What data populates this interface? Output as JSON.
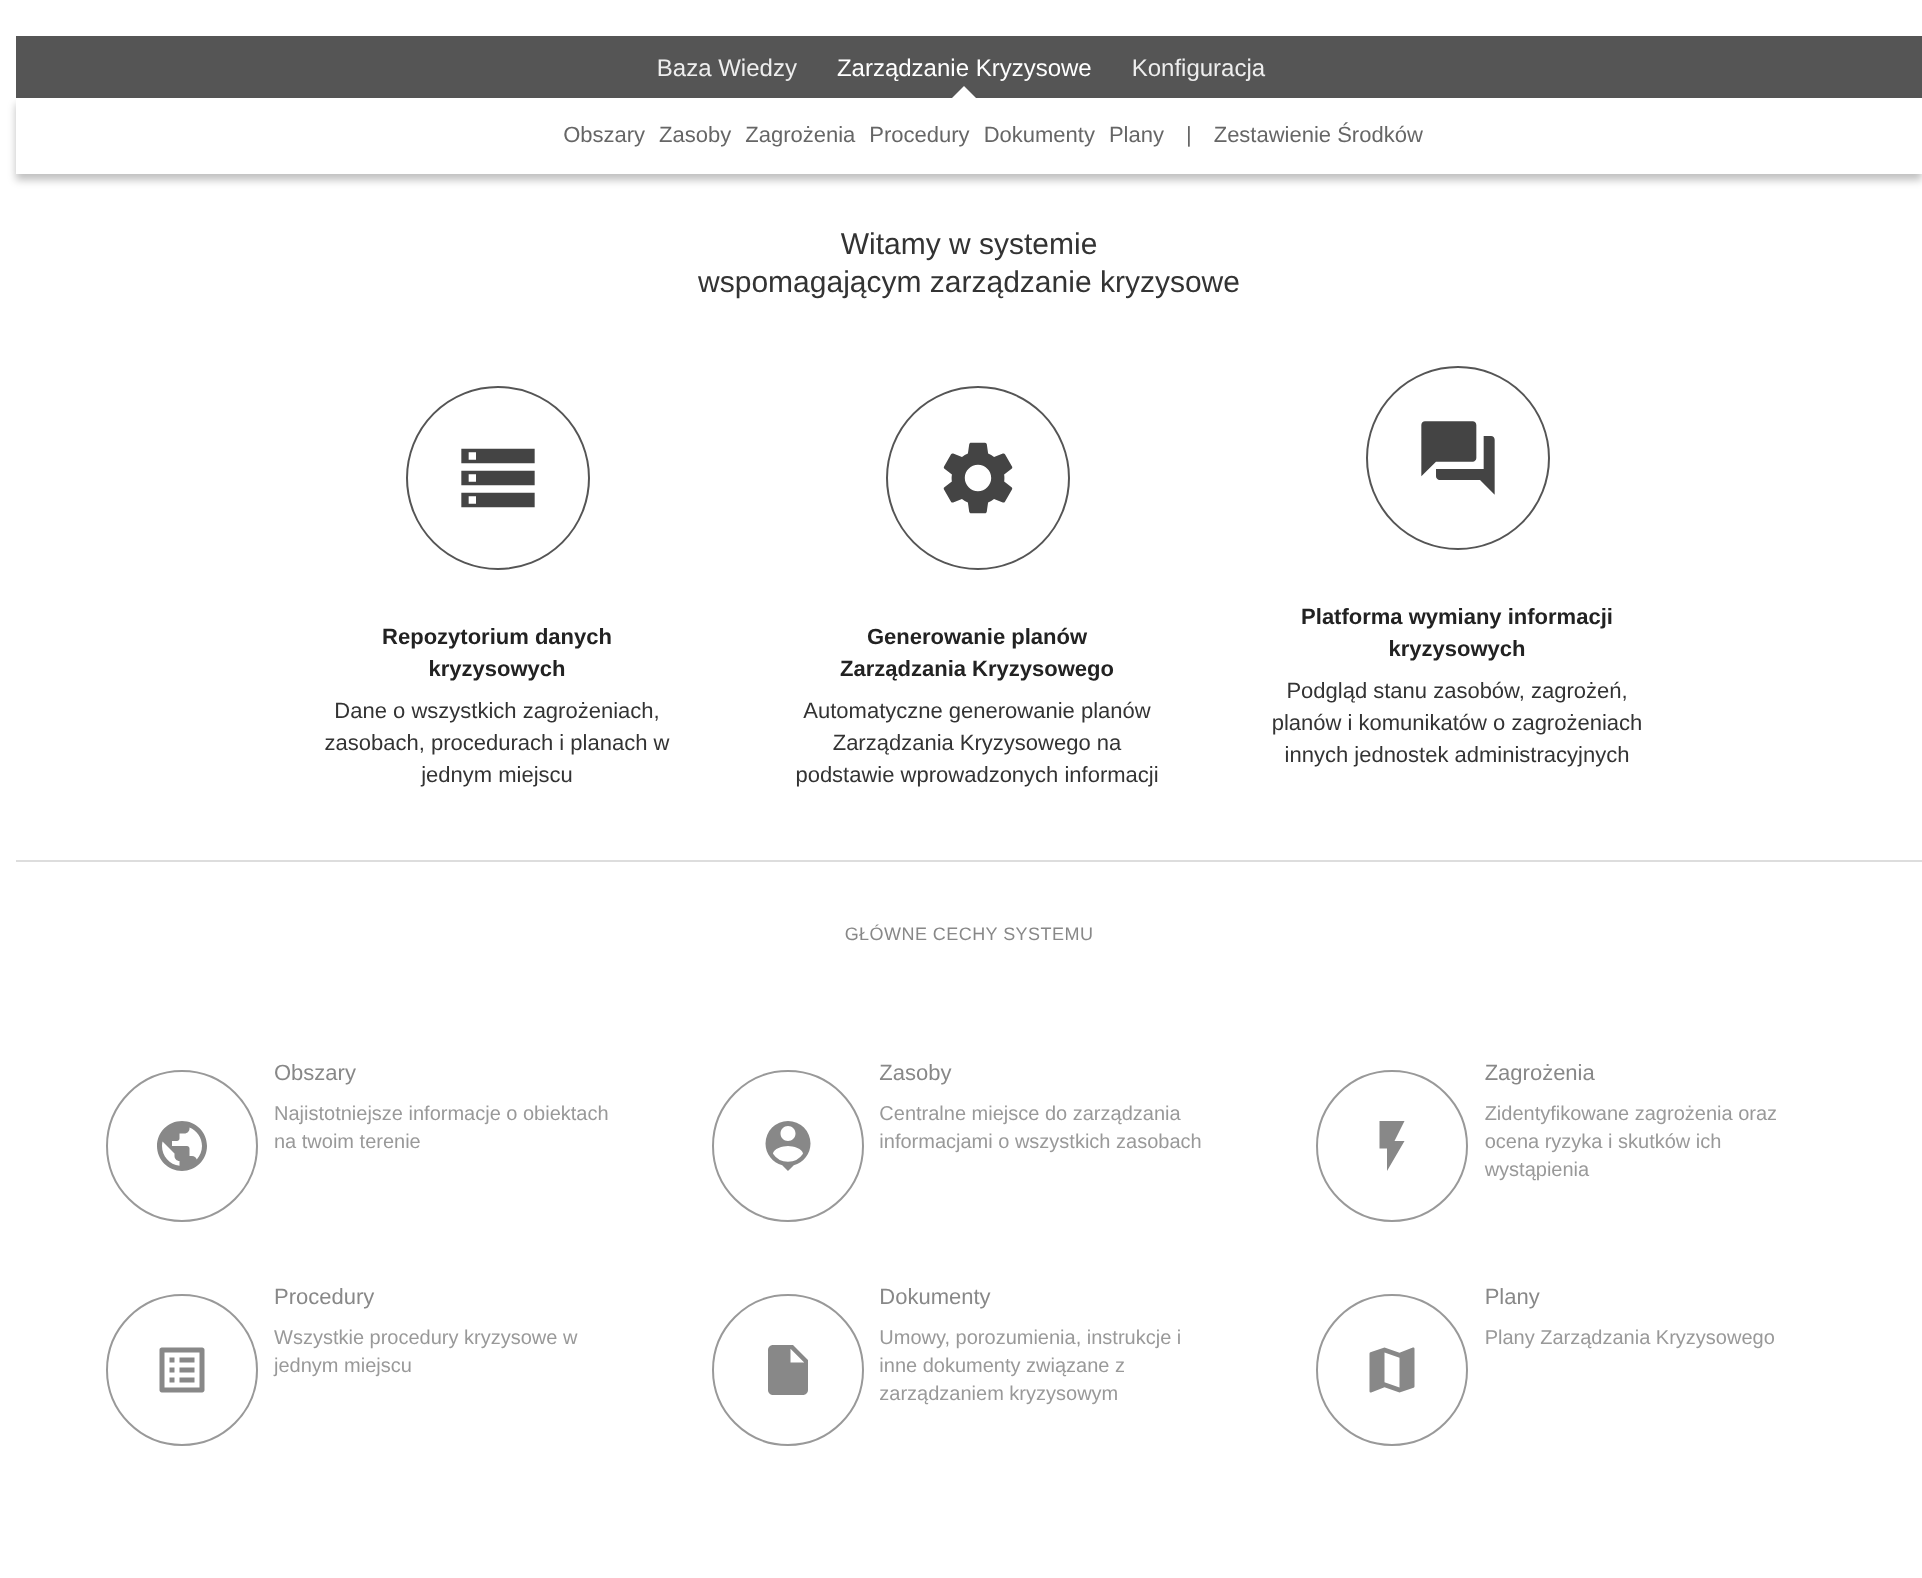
{
  "top_nav": [
    {
      "label": "Baza Wiedzy",
      "selected": false
    },
    {
      "label": "Zarządzanie Kryzysowe",
      "selected": true
    },
    {
      "label": "Konfiguracja",
      "selected": false
    }
  ],
  "sub_nav": {
    "items": [
      "Obszary",
      "Zasoby",
      "Zagrożenia",
      "Procedury",
      "Dokumenty",
      "Plany"
    ],
    "separator": "|",
    "extra": "Zestawienie Środków"
  },
  "welcome": {
    "line_1": "Witamy w systemie",
    "line_2": "wspomagającym zarządzanie kryzysowe"
  },
  "features": [
    {
      "kind": "server",
      "title": "Repozytorium danych kryzysowych",
      "text": "Dane o wszystkich zagrożeniach, zasobach, procedurach i planach w jednym miejscu"
    },
    {
      "kind": "gear",
      "title": "Generowanie planów Zarządzania Kryzysowego",
      "text": "Automatyczne generowanie planów Zarządzania Kryzysowego na podstawie wprowadzonych informacji"
    },
    {
      "kind": "chat",
      "title": "Platforma wymiany informacji kryzysowych",
      "text": "Podgląd stanu zasobów, zagrożeń, planów i komunikatów o zagrożeniach innych jednostek administracyjnych"
    }
  ],
  "main_features": {
    "heading": "GŁÓWNE CECHY SYSTEMU",
    "items": [
      {
        "kind": "globe",
        "title": "Obszary",
        "text": "Najistotniejsze informacje o obiektach na twoim terenie"
      },
      {
        "kind": "person",
        "title": "Zasoby",
        "text": "Centralne miejsce do zarządzania informacjami o wszystkich zasobach"
      },
      {
        "kind": "bolt",
        "title": "Zagrożenia",
        "text": "Zidentyfikowane zagrożenia oraz ocena ryzyka i skutków ich wystąpienia"
      },
      {
        "kind": "list",
        "title": "Procedury",
        "text": "Wszystkie procedury kryzysowe w jednym miejscu"
      },
      {
        "kind": "document",
        "title": "Dokumenty",
        "text": "Umowy, porozumienia, instrukcje i inne dokumenty związane z zarządzaniem kryzysowym"
      },
      {
        "kind": "map",
        "title": "Plany",
        "text": "Plany Zarządzania Kryzysowego"
      }
    ]
  }
}
